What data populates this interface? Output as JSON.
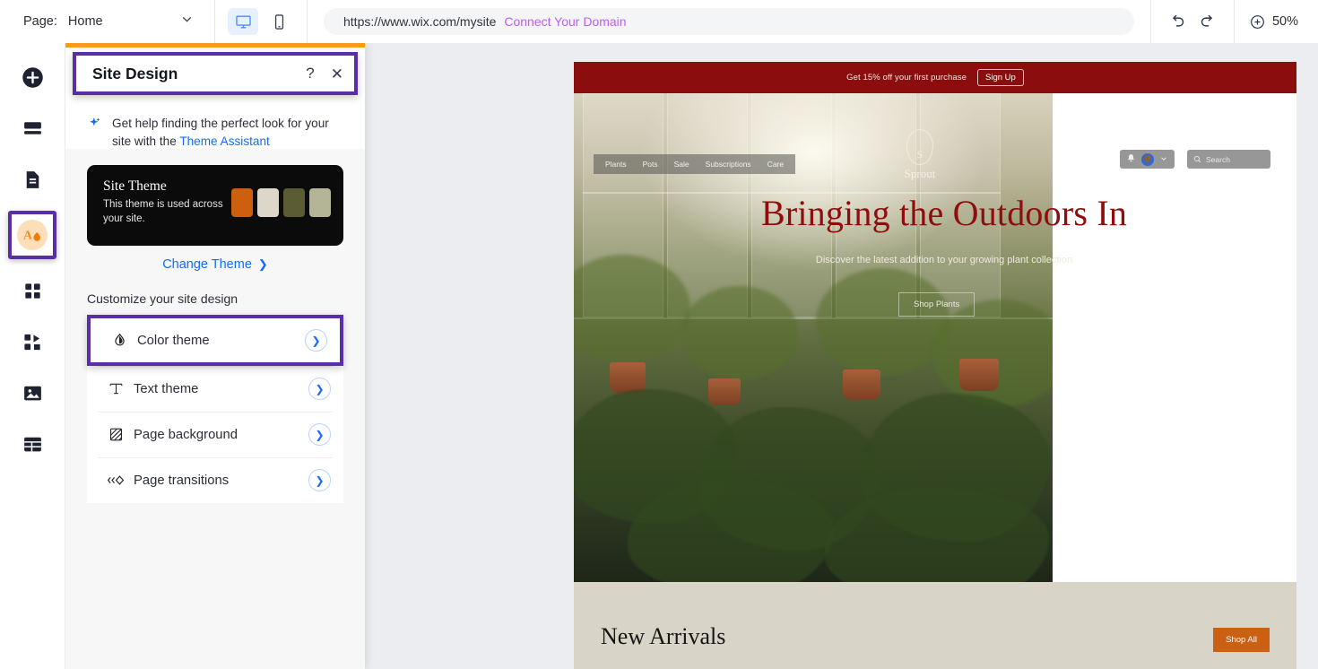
{
  "topbar": {
    "page_label": "Page:",
    "page_value": "Home",
    "chevron_icon": "chevron-down-icon",
    "desktop_icon": "desktop-monitor-icon",
    "mobile_icon": "mobile-phone-icon",
    "url": "https://www.wix.com/mysite",
    "connect_domain": "Connect Your Domain",
    "undo_icon": "undo-arrow-icon",
    "redo_icon": "redo-arrow-icon",
    "zoom_icon": "zoom-in-circle-icon",
    "zoom_value": "50%"
  },
  "rail": {
    "items": [
      {
        "name": "add-elements",
        "icon": "plus-circle-icon"
      },
      {
        "name": "add-section",
        "icon": "sections-icon"
      },
      {
        "name": "pages-menu",
        "icon": "page-document-icon"
      },
      {
        "name": "site-design",
        "icon": "site-design-droplet-icon",
        "selected": true
      },
      {
        "name": "app-market",
        "icon": "apps-grid-icon"
      },
      {
        "name": "dev-mode",
        "icon": "integrations-icon"
      },
      {
        "name": "media",
        "icon": "image-icon"
      },
      {
        "name": "cms",
        "icon": "table-icon"
      }
    ]
  },
  "panel": {
    "title": "Site Design",
    "help_icon": "question-mark-icon",
    "close_icon": "close-x-icon",
    "assistant": {
      "sparkle_icon": "sparkle-icon",
      "text_before": "Get help finding the perfect look for your site with the ",
      "link": "Theme Assistant"
    },
    "theme_card": {
      "title": "Site Theme",
      "subtitle": "This theme is used across your site.",
      "swatches": [
        "#cc600f",
        "#ddd7ca",
        "#5b5b34",
        "#b3b596"
      ]
    },
    "change_theme": "Change Theme",
    "change_theme_chevron": "chevron-right-icon",
    "customize_label": "Customize your site design",
    "menu": [
      {
        "label": "Color theme",
        "icon": "droplet-icon",
        "arrow": "chevron-right-circle-icon",
        "highlighted": true
      },
      {
        "label": "Text theme",
        "icon": "text-t-icon",
        "arrow": "chevron-right-circle-icon",
        "highlighted": false
      },
      {
        "label": "Page background",
        "icon": "background-hatch-icon",
        "arrow": "chevron-right-circle-icon",
        "highlighted": false
      },
      {
        "label": "Page transitions",
        "icon": "transitions-icon",
        "arrow": "chevron-right-circle-icon",
        "highlighted": false
      }
    ]
  },
  "site_preview": {
    "promo": {
      "text": "Get 15% off your first purchase",
      "button": "Sign Up"
    },
    "nav": [
      "Plants",
      "Pots",
      "Sale",
      "Subscriptions",
      "Care"
    ],
    "logo_letter": "S",
    "logo_name": "Sprout",
    "account": {
      "bell_icon": "notification-bell-icon",
      "avatar_icon": "user-avatar-icon",
      "chevron_icon": "chevron-down-icon"
    },
    "search": {
      "icon": "search-icon",
      "placeholder": "Search"
    },
    "hero": {
      "title": "Bringing the Outdoors In",
      "subtitle": "Discover the latest addition to your growing plant collection",
      "cta": "Shop Plants"
    },
    "new_arrivals": {
      "heading": "New Arrivals",
      "button": "Shop All"
    }
  },
  "colors": {
    "highlight": "#5a2ea6",
    "accent_orange": "#fb9a1b",
    "link_blue": "#1769ff",
    "domain_purple": "#c05cf0",
    "promo_red": "#8c0d0d",
    "hero_red": "#8f0d0d",
    "shop_orange": "#cc6012"
  }
}
